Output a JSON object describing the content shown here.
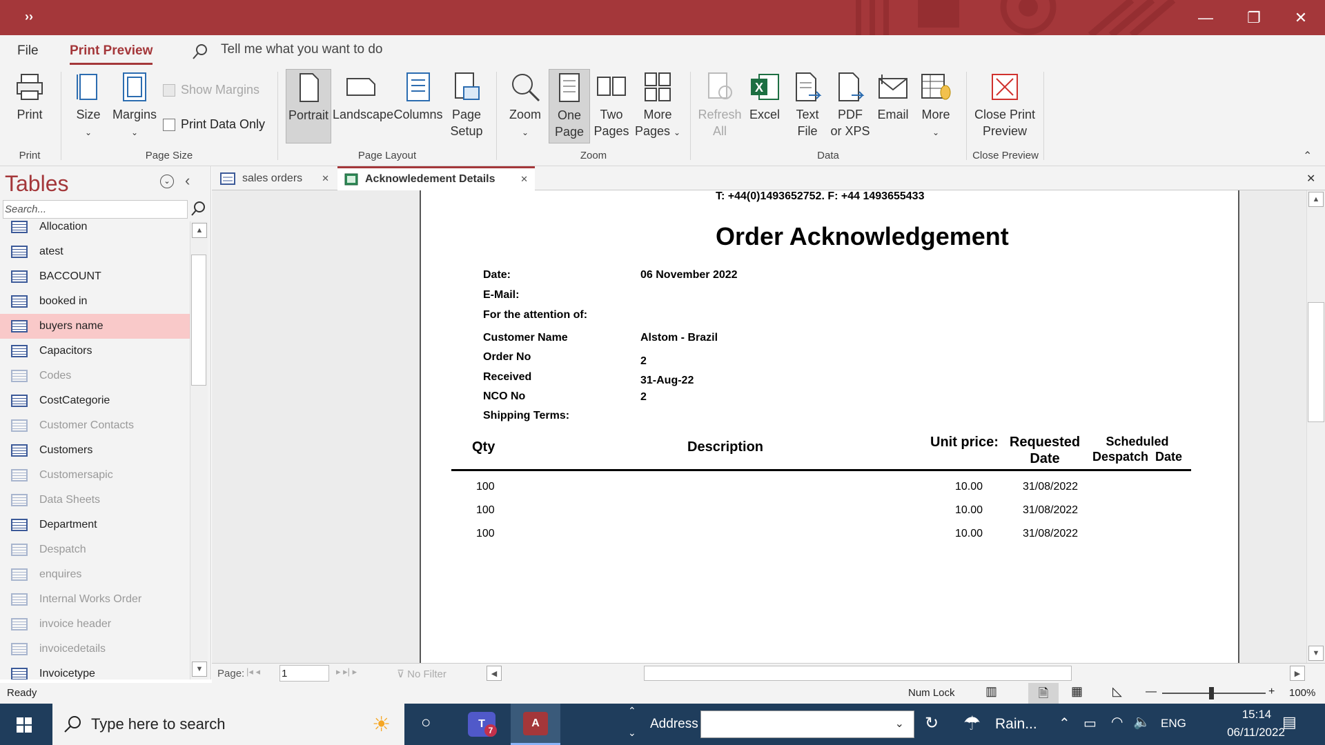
{
  "titlebar": {
    "qat_glyph": "››",
    "minimize": "—",
    "restore": "❐",
    "close": "✕"
  },
  "menu": {
    "file": "File",
    "print_preview": "Print Preview",
    "tell_me": "Tell me what you want to do"
  },
  "ribbon": {
    "print": "Print",
    "size": "Size",
    "margins": "Margins",
    "show_margins": "Show Margins",
    "print_data_only": "Print Data Only",
    "portrait": "Portrait",
    "landscape": "Landscape",
    "columns": "Columns",
    "page_setup_1": "Page",
    "page_setup_2": "Setup",
    "zoom": "Zoom",
    "one_page_1": "One",
    "one_page_2": "Page",
    "two_pages_1": "Two",
    "two_pages_2": "Pages",
    "more_pages_1": "More",
    "more_pages_2": "Pages",
    "refresh_1": "Refresh",
    "refresh_2": "All",
    "excel": "Excel",
    "text_file_1": "Text",
    "text_file_2": "File",
    "pdf_1": "PDF",
    "pdf_2": "or XPS",
    "email": "Email",
    "more": "More",
    "close_1": "Close Print",
    "close_2": "Preview",
    "groups": {
      "print": "Print",
      "page_size": "Page Size",
      "page_layout": "Page Layout",
      "zoom": "Zoom",
      "data": "Data",
      "close_preview": "Close Preview"
    }
  },
  "nav": {
    "title": "Tables",
    "search_placeholder": "Search...",
    "items": [
      {
        "label": "Allocation",
        "dim": false
      },
      {
        "label": "atest",
        "dim": false
      },
      {
        "label": "BACCOUNT",
        "dim": false
      },
      {
        "label": "booked in",
        "dim": false
      },
      {
        "label": "buyers name",
        "dim": false
      },
      {
        "label": "Capacitors",
        "dim": false
      },
      {
        "label": "Codes",
        "dim": true
      },
      {
        "label": "CostCategorie",
        "dim": false
      },
      {
        "label": "Customer Contacts",
        "dim": true
      },
      {
        "label": "Customers",
        "dim": false
      },
      {
        "label": "Customersapic",
        "dim": true
      },
      {
        "label": "Data Sheets",
        "dim": true
      },
      {
        "label": "Department",
        "dim": false
      },
      {
        "label": "Despatch",
        "dim": true
      },
      {
        "label": "enquires",
        "dim": true
      },
      {
        "label": "Internal Works Order",
        "dim": true
      },
      {
        "label": "invoice header",
        "dim": true
      },
      {
        "label": "invoicedetails",
        "dim": true
      },
      {
        "label": "Invoicetype",
        "dim": false
      }
    ],
    "selected": "buyers name"
  },
  "tabs": [
    {
      "label": "sales orders",
      "close": "✕"
    },
    {
      "label": "Acknowledement Details",
      "close": "✕"
    }
  ],
  "report": {
    "contact_line": "T: +44(0)1493652752. F: +44 1493655433",
    "title": "Order Acknowledgement",
    "date_label": "Date:",
    "date_value": "06 November 2022",
    "email_label": "E-Mail:",
    "attention_label": "For the attention of:",
    "customer_label": "Customer Name",
    "customer_value": "Alstom - Brazil",
    "order_label": "Order No",
    "order_value": "2",
    "received_label": "Received",
    "received_value": "31-Aug-22",
    "nco_label": "NCO No",
    "nco_value": "2",
    "shipping_label": "Shipping Terms:",
    "headers": {
      "qty": "Qty",
      "description": "Description",
      "unit_price": "Unit price:",
      "requested_1": "Requested",
      "requested_2": "Date",
      "scheduled_1": "Scheduled",
      "scheduled_2": "Despatch  Date"
    },
    "rows": [
      {
        "qty": "100",
        "price": "10.00",
        "date": "31/08/2022"
      },
      {
        "qty": "100",
        "price": "10.00",
        "date": "31/08/2022"
      },
      {
        "qty": "100",
        "price": "10.00",
        "date": "31/08/2022"
      }
    ]
  },
  "recnav": {
    "page_label": "Page:",
    "page_value": "1",
    "filter": "No Filter"
  },
  "status": {
    "ready": "Ready",
    "num_lock": "Num Lock",
    "zoom": "100%"
  },
  "taskbar": {
    "search": "Type here to search",
    "address": "Address",
    "weather": "Rain...",
    "lang": "ENG",
    "time": "15:14",
    "date": "06/11/2022",
    "teams_badge": "7"
  }
}
